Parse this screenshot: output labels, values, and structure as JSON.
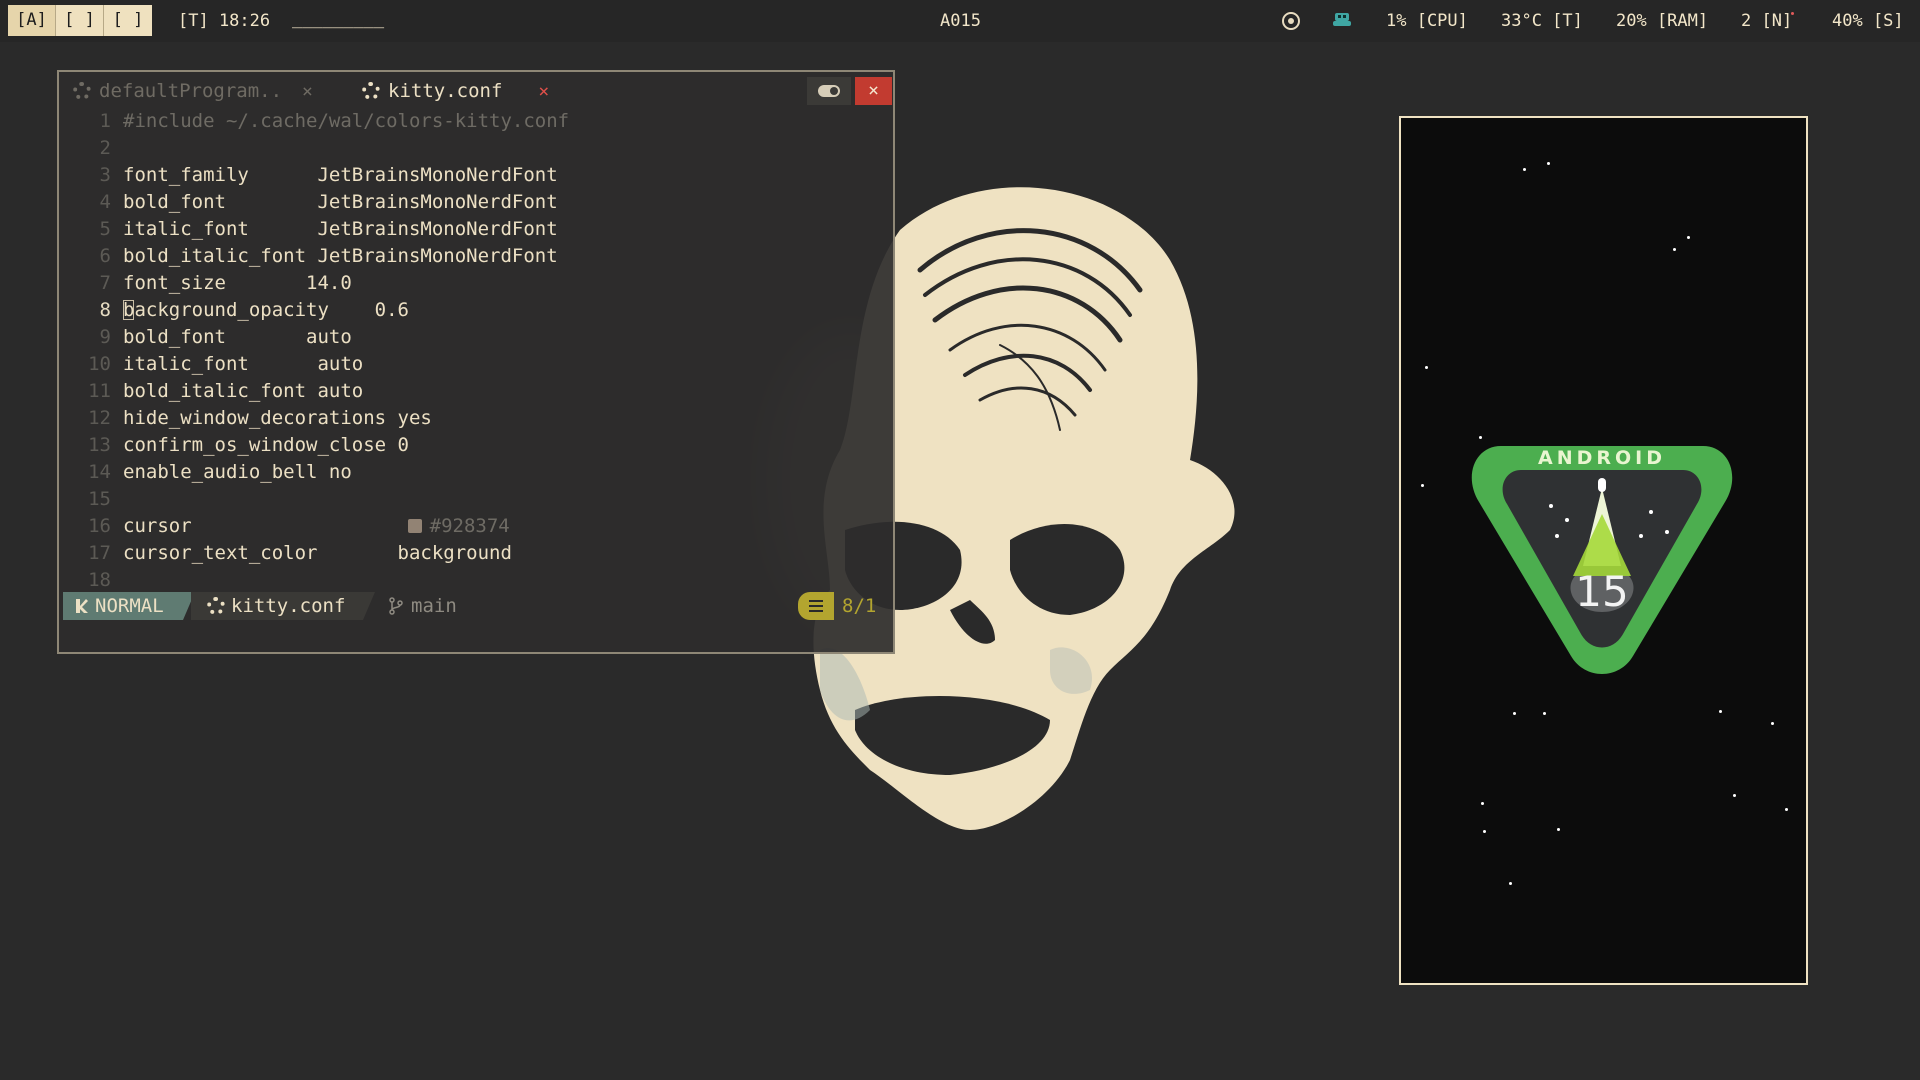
{
  "topbar": {
    "workspaces": [
      "[A]",
      "[ ]",
      "[ ]"
    ],
    "time": "[T] 18:26",
    "title_placeholder": "_________",
    "center_title": "A015",
    "cpu": "1% [CPU]",
    "temp": "33°C [T]",
    "ram": "20% [RAM]",
    "notifications": "2 [N]",
    "storage": "40% [S]"
  },
  "editor": {
    "tabs": [
      {
        "label": "defaultProgram..",
        "close": "×",
        "active": false
      },
      {
        "label": "kitty.conf",
        "close": "×",
        "active": true
      }
    ],
    "close_label": "×",
    "lines": [
      {
        "n": "1",
        "text": "#include ~/.cache/wal/colors-kitty.conf"
      },
      {
        "n": "2",
        "text": ""
      },
      {
        "n": "3",
        "text": "font_family      JetBrainsMonoNerdFont"
      },
      {
        "n": "4",
        "text": "bold_font        JetBrainsMonoNerdFont"
      },
      {
        "n": "5",
        "text": "italic_font      JetBrainsMonoNerdFont"
      },
      {
        "n": "6",
        "text": "bold_italic_font JetBrainsMonoNerdFont"
      },
      {
        "n": "7",
        "text": "font_size       14.0"
      },
      {
        "n": "8",
        "text": "background_opacity    0.6"
      },
      {
        "n": "9",
        "text": "bold_font       auto"
      },
      {
        "n": "10",
        "text": "italic_font      auto"
      },
      {
        "n": "11",
        "text": "bold_italic_font auto"
      },
      {
        "n": "12",
        "text": "hide_window_decorations yes"
      },
      {
        "n": "13",
        "text": "confirm_os_window_close 0"
      },
      {
        "n": "14",
        "text": "enable_audio_bell no"
      },
      {
        "n": "15",
        "text": ""
      },
      {
        "n": "16",
        "text": "cursor",
        "value": "#928374"
      },
      {
        "n": "17",
        "text": "cursor_text_color       background"
      },
      {
        "n": "18",
        "text": ""
      }
    ],
    "current_line": "8",
    "status": {
      "mode": "NORMAL",
      "file": "kitty.conf",
      "branch": "main",
      "position": "8/1"
    }
  },
  "android": {
    "label": "ANDROID",
    "version": "15"
  },
  "colors": {
    "background": "#2a2a2a",
    "cream": "#efe1bf",
    "accent_green": "#4cae4f",
    "mode_bg": "#5f7b72",
    "position_yellow": "#b3a52f",
    "close_red": "#c23b30",
    "cursor_swatch": "#928374"
  }
}
